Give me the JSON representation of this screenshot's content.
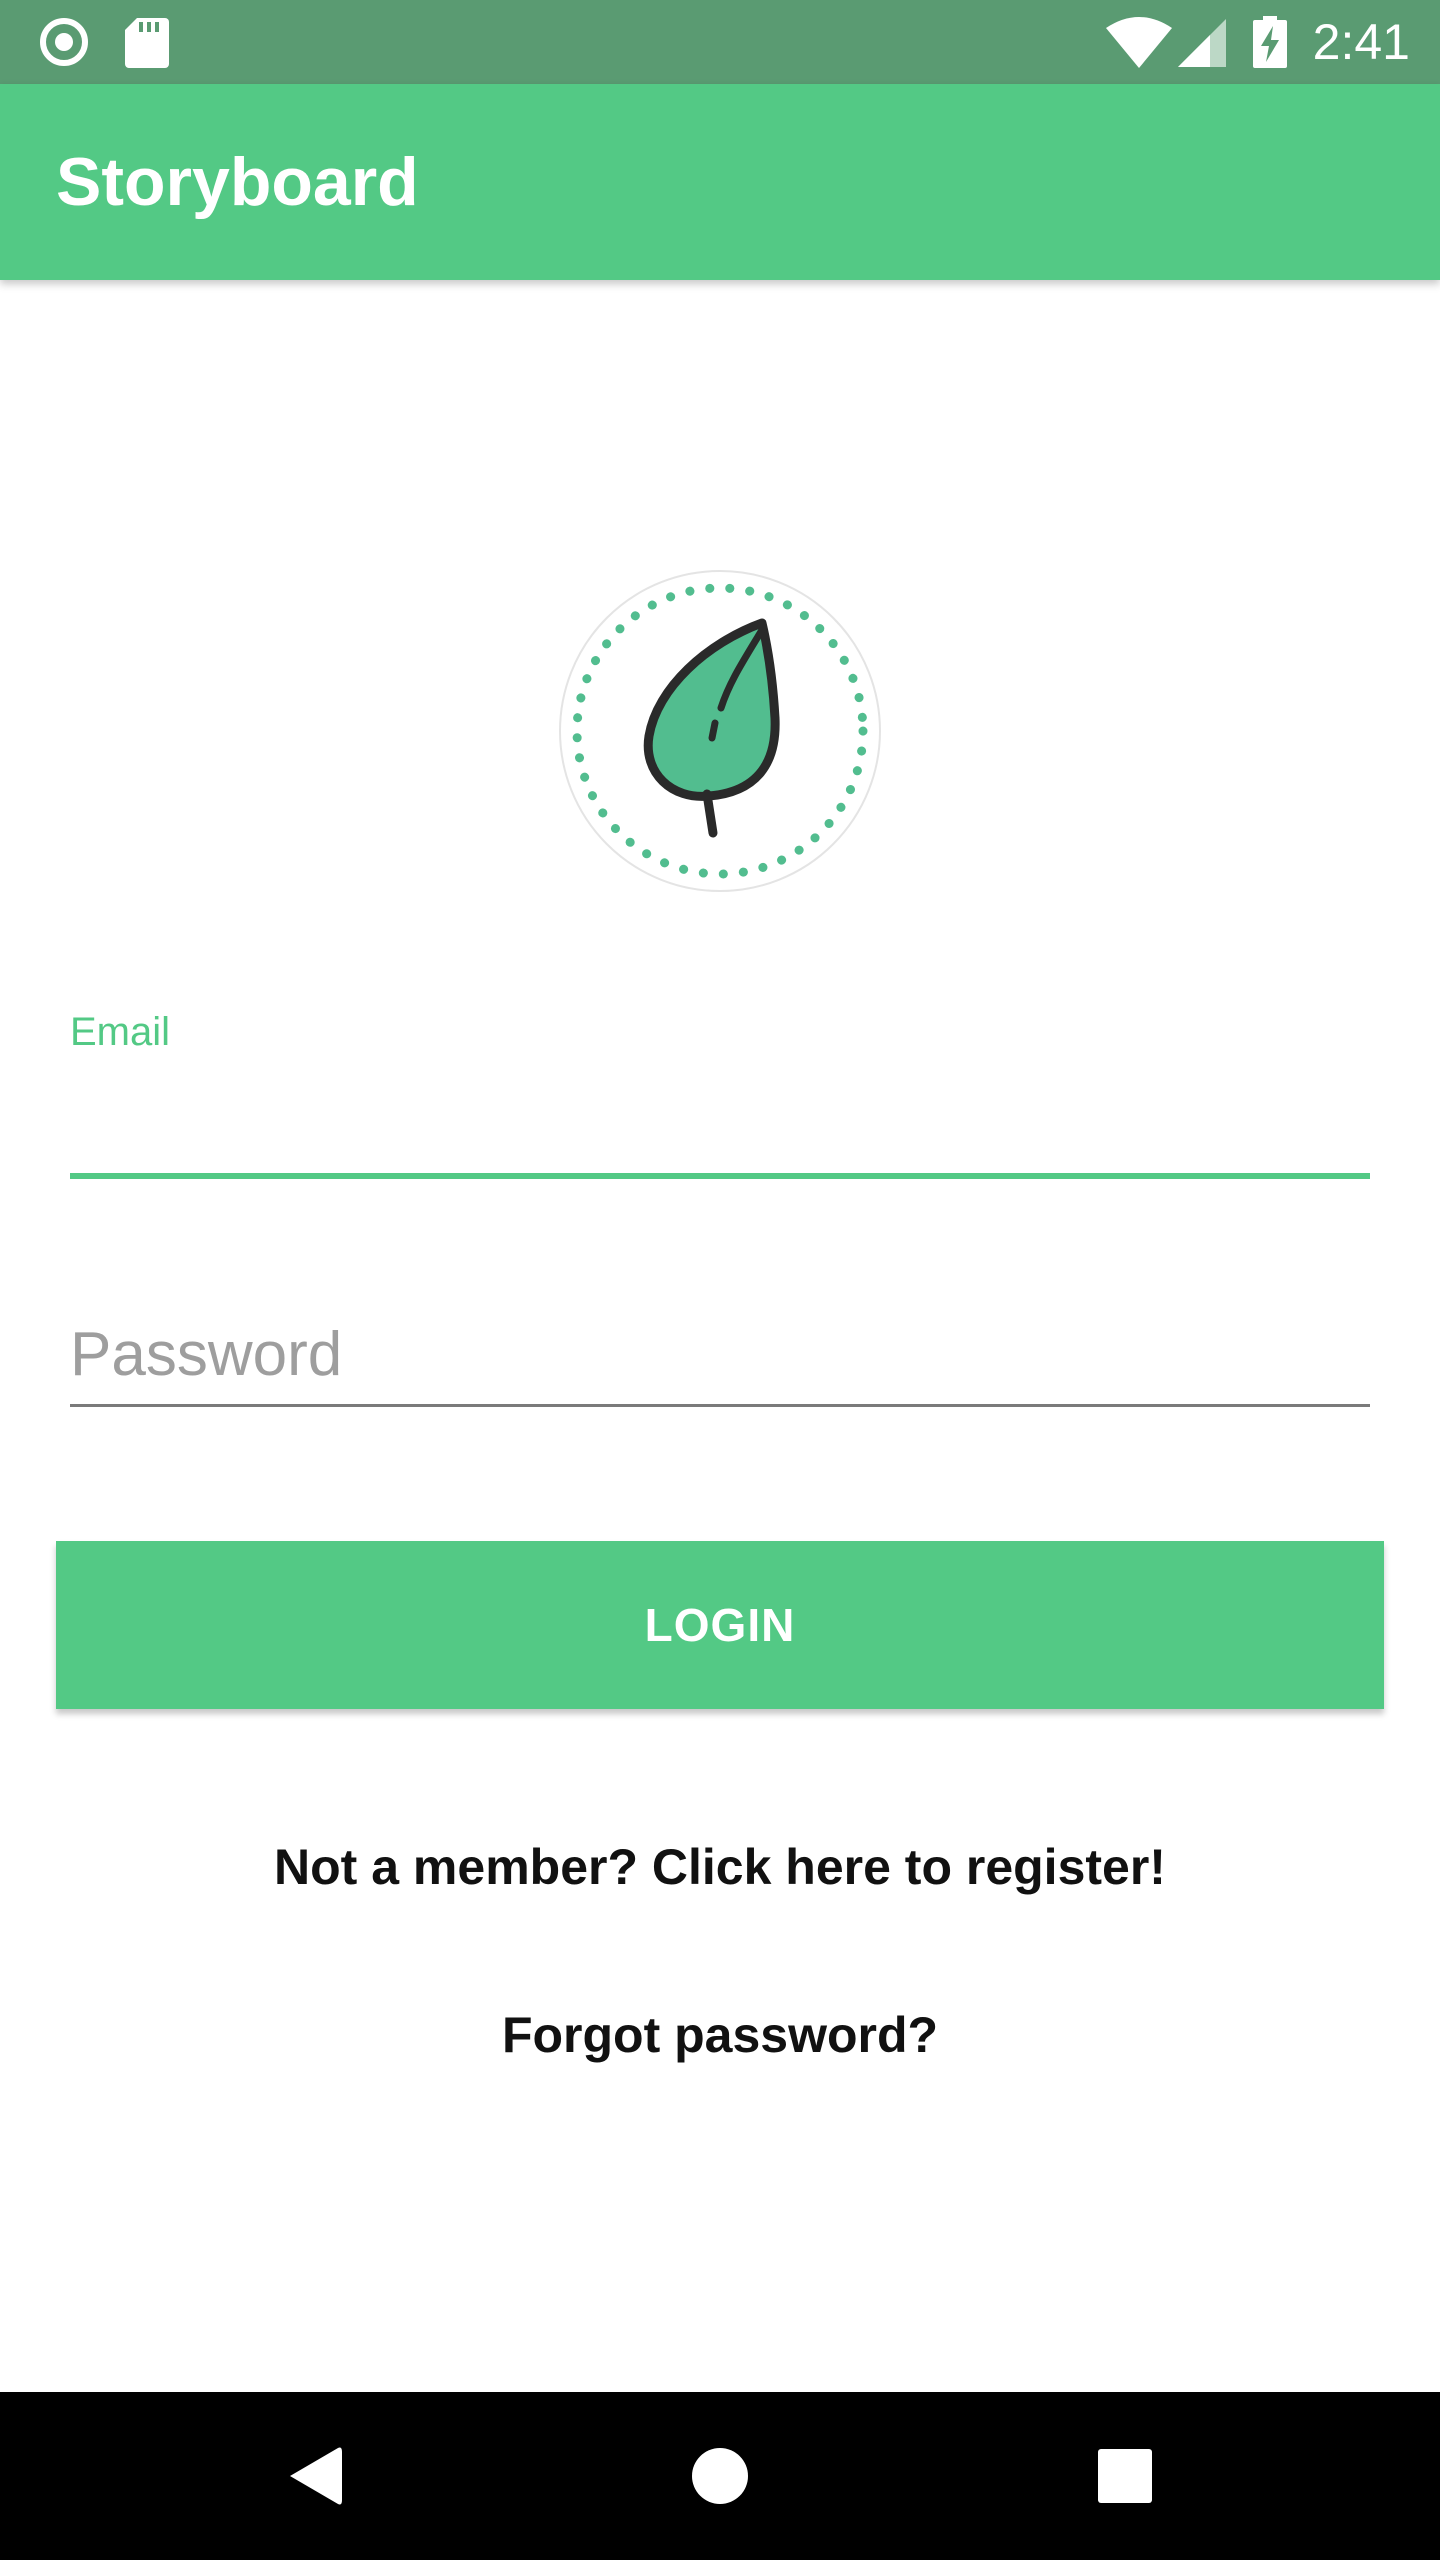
{
  "status_bar": {
    "time": "2:41",
    "left_icons": [
      "record-icon",
      "sd-card-icon"
    ],
    "right_icons": [
      "wifi-icon",
      "cell-signal-icon",
      "battery-charging-icon"
    ]
  },
  "app_bar": {
    "title": "Storyboard"
  },
  "logo": {
    "icon": "leaf-logo-icon"
  },
  "form": {
    "email_label": "Email",
    "email_value": "",
    "password_placeholder": "Password",
    "password_value": "",
    "login_label": "LOGIN"
  },
  "links": {
    "register": "Not a member? Click here to register!",
    "forgot": "Forgot password?"
  },
  "nav_bar": {
    "buttons": [
      "back-icon",
      "home-icon",
      "recents-icon"
    ]
  },
  "colors": {
    "accent": "#53c985",
    "status_bar": "#5a9b72",
    "nav_bar": "#000000",
    "leaf_fill": "#52bd8f"
  }
}
